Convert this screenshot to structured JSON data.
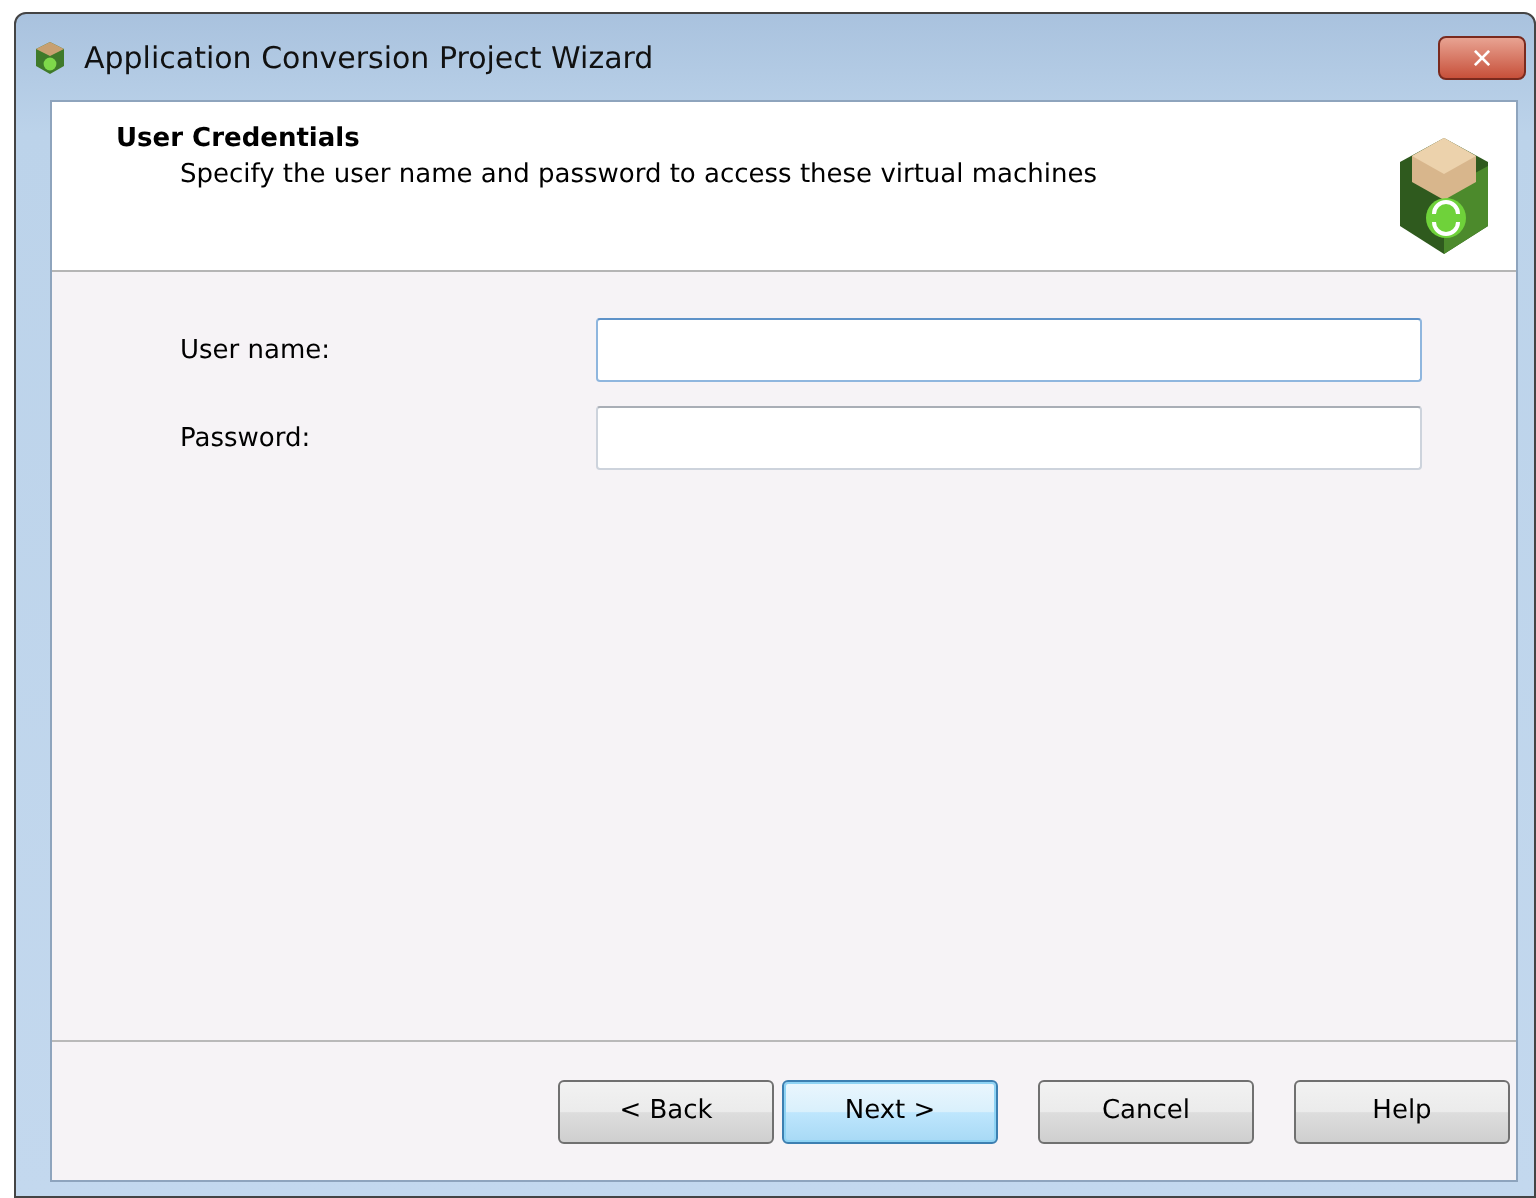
{
  "window": {
    "title": "Application Conversion Project Wizard",
    "close": "×"
  },
  "header": {
    "title": "User Credentials",
    "subtitle": "Specify the user name and password to access these virtual machines"
  },
  "fields": [
    {
      "label": "User name:",
      "focused": true
    },
    {
      "label": "Password:",
      "focused": false
    }
  ],
  "buttons": [
    {
      "label": "< Back",
      "default": false
    },
    {
      "label": "Next >",
      "default": true
    },
    {
      "label": "Cancel",
      "default": false
    },
    {
      "label": "Help",
      "default": false
    }
  ]
}
